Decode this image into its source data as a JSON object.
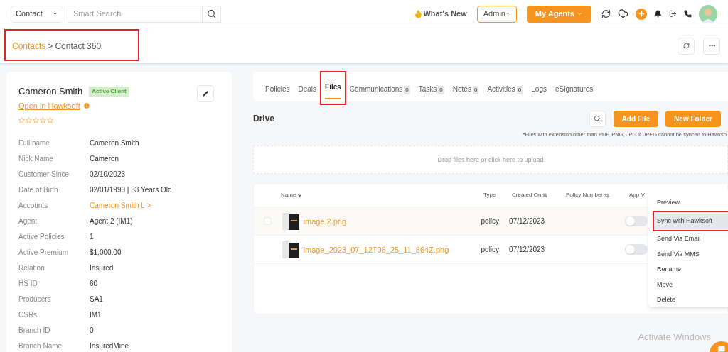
{
  "topbar": {
    "module_select": "Contact",
    "search": {
      "placeholder": "Smart Search"
    },
    "whats_new": "What's New",
    "role_select": "Admin",
    "agents_button": "My Agents"
  },
  "breadcrumb": {
    "parent": "Contacts",
    "separator": ">",
    "current": "Contact 360"
  },
  "contact": {
    "name": "Cameron Smith",
    "badge": "Active Client",
    "hawksoft_link": "Open in Hawksoft",
    "stars": 0,
    "fields": [
      {
        "label": "Full name",
        "value": "Cameron Smith",
        "kind": "text"
      },
      {
        "label": "Nick Name",
        "value": "Cameron",
        "kind": "text"
      },
      {
        "label": "Customer Since",
        "value": "02/10/2023",
        "kind": "text"
      },
      {
        "label": "Date of Birth",
        "value": "02/01/1990 | 33 Years Old",
        "kind": "text"
      },
      {
        "label": "Accounts",
        "value": "Cameron Smith L >",
        "kind": "link"
      },
      {
        "label": "Agent",
        "value": "Agent 2 (IM1)",
        "kind": "text"
      },
      {
        "label": "Active Policies",
        "value": "1",
        "kind": "text"
      },
      {
        "label": "Active Premium",
        "value": "$1,000.00",
        "kind": "text"
      },
      {
        "label": "Relation",
        "value": "Insured",
        "kind": "text"
      },
      {
        "label": "HS ID",
        "value": "60",
        "kind": "text"
      },
      {
        "label": "Producers",
        "value": "SA1",
        "kind": "text"
      },
      {
        "label": "CSRs",
        "value": "IM1",
        "kind": "text"
      },
      {
        "label": "Branch ID",
        "value": "0",
        "kind": "text"
      },
      {
        "label": "Branch Name",
        "value": "InsuredMine",
        "kind": "text"
      }
    ]
  },
  "tabs": [
    {
      "label": "Policies",
      "selected": false
    },
    {
      "label": "Deals",
      "selected": false
    },
    {
      "label": "Files",
      "selected": true,
      "annotated": true
    },
    {
      "label": "Communications",
      "count": "0",
      "selected": false
    },
    {
      "label": "Tasks",
      "count": "0",
      "selected": false
    },
    {
      "label": "Notes",
      "count": "0",
      "selected": false
    },
    {
      "label": "Activities",
      "count": "0",
      "selected": false
    },
    {
      "label": "Logs",
      "selected": false
    },
    {
      "label": "eSignatures",
      "selected": false
    }
  ],
  "drive": {
    "title": "Drive",
    "buttons": [
      "Add File",
      "New Folder"
    ],
    "note": "*Files with extension other than PDF, PNG, JPG & JPEG cannot be synced to Hawkso",
    "dropzone": "Drop files here or click here to upload"
  },
  "table": {
    "columns": [
      "Name",
      "Type",
      "Created On",
      "Policy Number",
      "App V"
    ],
    "rows": [
      {
        "name": "image 2.png",
        "type": "policy",
        "created_on": "07/12/2023",
        "hovered": true,
        "app_visible": false
      },
      {
        "name": "image_2023_07_12T06_25_11_864Z.png",
        "type": "policy",
        "created_on": "07/12/2023",
        "hovered": false,
        "app_visible": false
      }
    ]
  },
  "context_menu": [
    {
      "label": "Preview",
      "selected": false
    },
    {
      "label": "Sync with Hawksoft",
      "selected": true,
      "annotated": true
    },
    {
      "label": "Send Via Email",
      "selected": false
    },
    {
      "label": "Send Via MMS",
      "selected": false
    },
    {
      "label": "Rename",
      "selected": false
    },
    {
      "label": "Move",
      "selected": false
    },
    {
      "label": "Delete",
      "selected": false
    }
  ],
  "os_notice": "Activate Windows"
}
